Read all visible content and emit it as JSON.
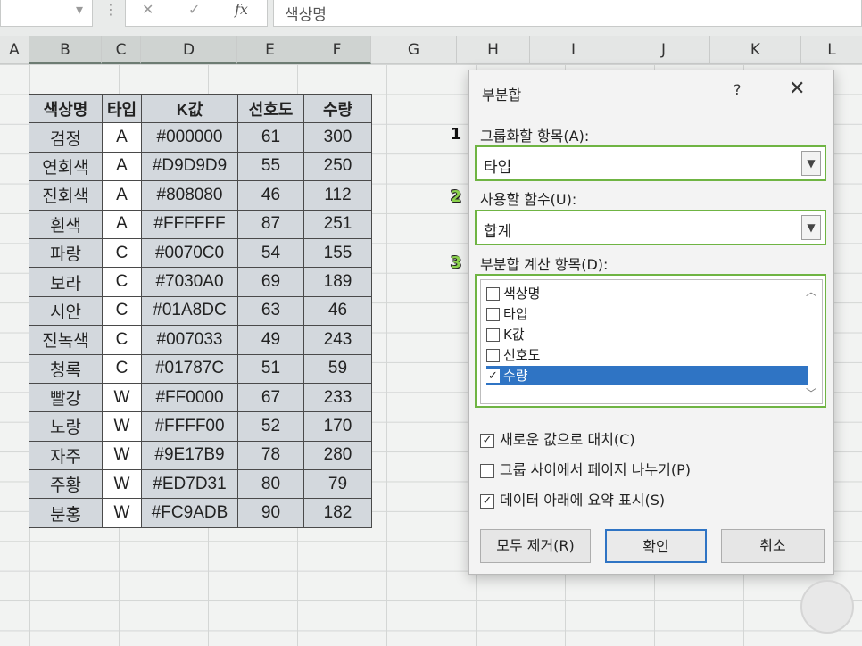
{
  "formula_bar": {
    "cancel_icon": "✕",
    "enter_icon": "✓",
    "fx_icon": "fx",
    "content": "색상명"
  },
  "columns": [
    "A",
    "B",
    "C",
    "D",
    "E",
    "F",
    "G",
    "H",
    "I",
    "J",
    "K",
    "L"
  ],
  "table": {
    "headers": [
      "색상명",
      "타입",
      "K값",
      "선호도",
      "수량"
    ],
    "rows": [
      [
        "검정",
        "A",
        "#000000",
        "61",
        "300"
      ],
      [
        "연회색",
        "A",
        "#D9D9D9",
        "55",
        "250"
      ],
      [
        "진회색",
        "A",
        "#808080",
        "46",
        "112"
      ],
      [
        "흰색",
        "A",
        "#FFFFFF",
        "87",
        "251"
      ],
      [
        "파랑",
        "C",
        "#0070C0",
        "54",
        "155"
      ],
      [
        "보라",
        "C",
        "#7030A0",
        "69",
        "189"
      ],
      [
        "시안",
        "C",
        "#01A8DC",
        "63",
        "46"
      ],
      [
        "진녹색",
        "C",
        "#007033",
        "49",
        "243"
      ],
      [
        "청록",
        "C",
        "#01787C",
        "51",
        "59"
      ],
      [
        "빨강",
        "W",
        "#FF0000",
        "67",
        "233"
      ],
      [
        "노랑",
        "W",
        "#FFFF00",
        "52",
        "170"
      ],
      [
        "자주",
        "W",
        "#9E17B9",
        "78",
        "280"
      ],
      [
        "주황",
        "W",
        "#ED7D31",
        "80",
        "79"
      ],
      [
        "분홍",
        "W",
        "#FC9ADB",
        "90",
        "182"
      ]
    ]
  },
  "dialog": {
    "title": "부분합",
    "help": "?",
    "close": "✕",
    "group_label": "그룹화할 항목(A):",
    "group_value": "타입",
    "func_label": "사용할 함수(U):",
    "func_value": "합계",
    "calc_label": "부분합 계산 항목(D):",
    "calc_items": [
      {
        "label": "색상명",
        "checked": false
      },
      {
        "label": "타입",
        "checked": false
      },
      {
        "label": "K값",
        "checked": false
      },
      {
        "label": "선호도",
        "checked": false
      },
      {
        "label": "수량",
        "checked": true
      }
    ],
    "opt_replace": "새로운 값으로 대치(C)",
    "opt_pagebreak": "그룹 사이에서 페이지 나누기(P)",
    "opt_summary": "데이터 아래에 요약 표시(S)",
    "btn_remove_all": "모두 제거(R)",
    "btn_ok": "확인",
    "btn_cancel": "취소",
    "step1": "1",
    "step2": "2",
    "step3": "3"
  },
  "colors": {
    "accent_green": "#6fb443",
    "selection_blue": "#2f74c4",
    "header_fill": "#d3d8dd"
  }
}
